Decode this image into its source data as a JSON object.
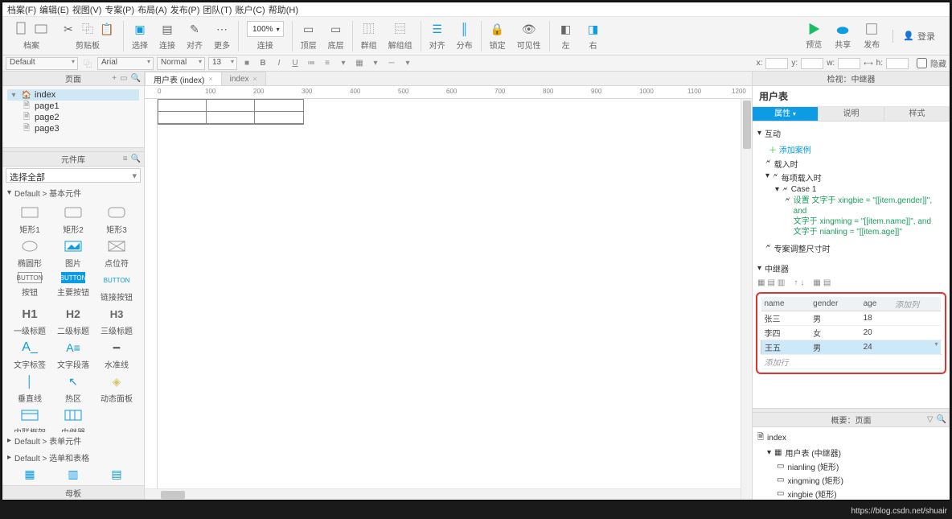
{
  "menu": [
    "档案(F)",
    "编辑(E)",
    "视图(V)",
    "专案(P)",
    "布局(A)",
    "发布(P)",
    "团队(T)",
    "账户(C)",
    "帮助(H)"
  ],
  "toolbar1": {
    "group1_labels": [
      "档案",
      "剪贴板"
    ],
    "group2": [
      "选择",
      "连接",
      "对齐",
      "更多"
    ],
    "zoom": "100%",
    "group3": [
      "连接"
    ],
    "group4": [
      "顶层",
      "底层"
    ],
    "group5": [
      "群组",
      "解组组"
    ],
    "group6": [
      "对齐",
      "分布"
    ],
    "group7": [
      "锁定",
      "可见性"
    ],
    "group8": [
      "左",
      "右"
    ],
    "right": [
      "预览",
      "共享",
      "发布"
    ],
    "login": "登录"
  },
  "toolbar2": {
    "style1": "Default",
    "font": "Arial",
    "weight": "Normal",
    "size": "13",
    "coords": {
      "x": "",
      "y": "",
      "w": "",
      "h": ""
    },
    "hidden_label": "隐藏"
  },
  "pages_panel": {
    "title": "页面",
    "root": "index",
    "pages": [
      "page1",
      "page2",
      "page3"
    ]
  },
  "library": {
    "title": "元件库",
    "selector": "选择全部",
    "cat1": "Default > 基本元件",
    "items": [
      [
        "矩形1",
        "矩形2",
        "矩形3"
      ],
      [
        "椭圆形",
        "图片",
        "点位符"
      ],
      [
        "按钮",
        "主要按钮",
        "链接按钮"
      ],
      [
        "一级标题",
        "二级标题",
        "三级标题"
      ],
      [
        "文字标签",
        "文字段落",
        "水准线"
      ],
      [
        "垂直线",
        "热区",
        "动态面板"
      ],
      [
        "内联框架",
        "中继器",
        ""
      ]
    ],
    "heads": [
      "H1",
      "H2",
      "H3"
    ],
    "cat2": "Default > 表单元件",
    "cat3": "Default > 选单和表格",
    "master": "母板"
  },
  "canvas": {
    "tabs": [
      {
        "label": "用户表 (index)",
        "active": true
      },
      {
        "label": "index",
        "active": false
      }
    ],
    "ruler_marks": [
      "0",
      "100",
      "200",
      "300",
      "400",
      "500",
      "600",
      "700",
      "800",
      "900",
      "1000",
      "1100",
      "1200"
    ]
  },
  "inspector": {
    "top_title": "检视：中继器",
    "widget_title": "用户表",
    "tabs": [
      "属性",
      "说明",
      "样式"
    ],
    "active_tab": 0,
    "interaction": {
      "label": "互动",
      "add": "添加案例",
      "events": [
        "载入时",
        "每项载入时"
      ],
      "case": "Case 1",
      "action_lines": [
        "设置 文字于 xingbie = \"[[item.gender]]\", and",
        "文字于 xingming = \"[[item.name]]\", and",
        "文字于 nianling = \"[[item.age]]\""
      ],
      "resize": "专案调整尺寸时"
    },
    "repeater": {
      "label": "中继器",
      "columns": [
        "name",
        "gender",
        "age",
        "添加列"
      ],
      "rows": [
        [
          "张三",
          "男",
          "18"
        ],
        [
          "李四",
          "女",
          "20"
        ],
        [
          "王五",
          "男",
          "24"
        ]
      ],
      "add_row": "添加行",
      "selected_row": 2
    }
  },
  "outline": {
    "title": "概要：页面",
    "root": "index",
    "repeater": "用户表 (中继器)",
    "children": [
      "nianling (矩形)",
      "xingming (矩形)",
      "xingbie (矩形)"
    ]
  },
  "footer_url": "https://blog.csdn.net/shuair"
}
